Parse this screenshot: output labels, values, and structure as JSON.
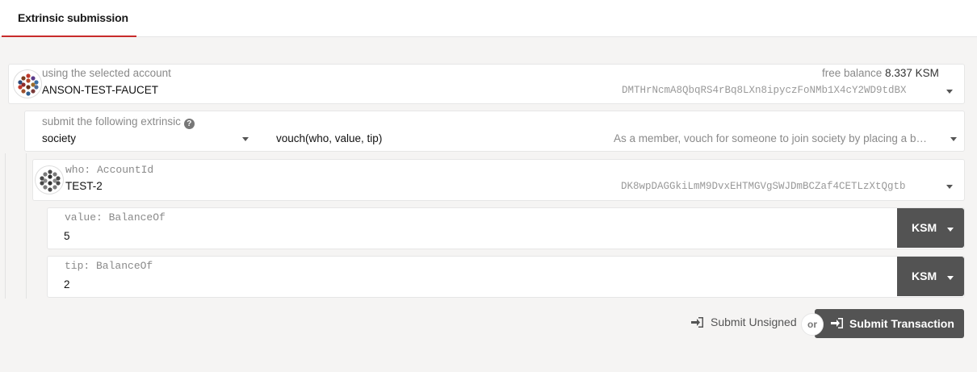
{
  "tabs": [
    {
      "label": "Extrinsic submission"
    }
  ],
  "account": {
    "label": "using the selected account",
    "name": "ANSON-TEST-FAUCET",
    "balance_label": "free balance",
    "balance_value": "8.337 KSM",
    "address": "DMTHrNcmA8QbqRS4rBq8LXn8ipyczFoNMb1X4cY2WD9tdBX"
  },
  "extrinsic": {
    "label": "submit the following extrinsic",
    "module": "society",
    "method": "vouch(who, value, tip)",
    "description": "As a member, vouch for someone to join society by placing a b…"
  },
  "params": {
    "who": {
      "label": "who: AccountId",
      "name": "TEST-2",
      "address": "DK8wpDAGGkiLmM9DvxEHTMGVgSWJDmBCZaf4CETLzXtQgtb"
    },
    "value": {
      "label": "value: BalanceOf",
      "amount": "5",
      "unit": "KSM"
    },
    "tip": {
      "label": "tip: BalanceOf",
      "amount": "2",
      "unit": "KSM"
    }
  },
  "actions": {
    "unsigned_label": "Submit Unsigned",
    "or_label": "or",
    "submit_label": "Submit Transaction"
  },
  "icons": {
    "help": "question-circle-icon",
    "sign_in": "sign-in-icon",
    "caret": "caret-down-icon"
  },
  "colors": {
    "accent": "#c82b2b",
    "button_dark": "#535353"
  }
}
